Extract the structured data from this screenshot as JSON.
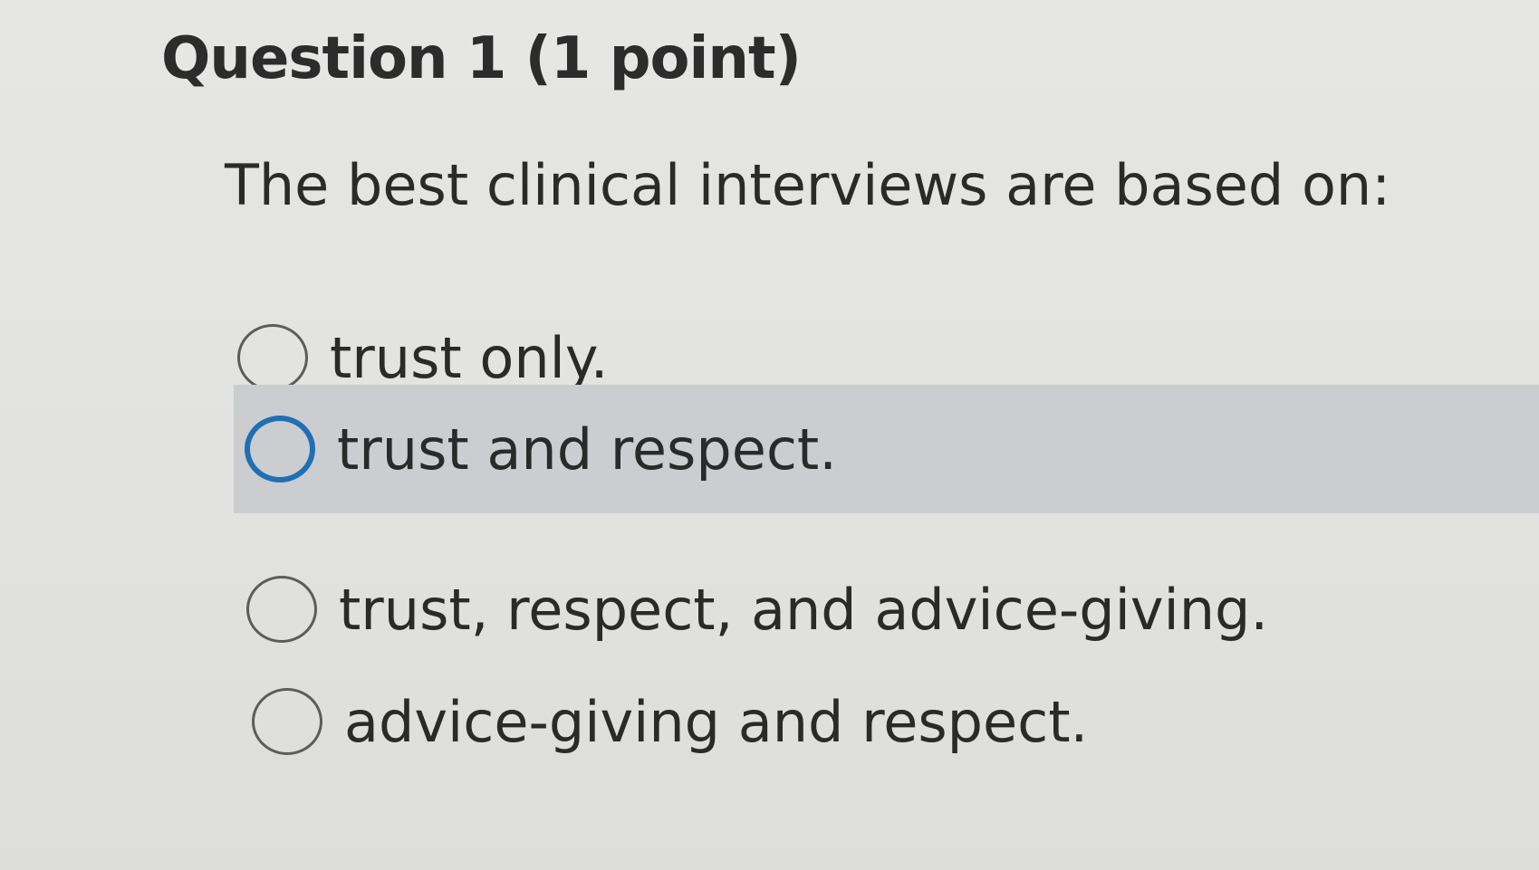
{
  "question": {
    "title": "Question 1 (1 point)",
    "prompt": "The best clinical interviews are based on:",
    "options": [
      {
        "label": "trust only.",
        "state": "unselected"
      },
      {
        "label": "trust and respect.",
        "state": "hovered-focused"
      },
      {
        "label": "trust, respect, and advice-giving.",
        "state": "unselected"
      },
      {
        "label": "advice-giving and respect.",
        "state": "unselected"
      }
    ]
  },
  "colors": {
    "background": "#e4e4e2",
    "hover_highlight": "#cbcdd0",
    "focus_ring": "#1f6fb5",
    "text": "#2a2a2a"
  }
}
